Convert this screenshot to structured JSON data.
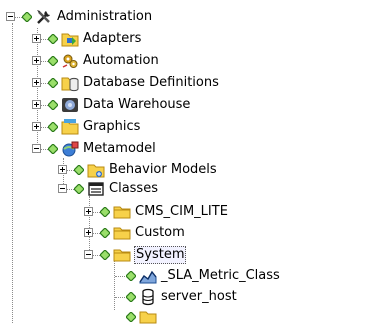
{
  "tree": {
    "nodes": [
      {
        "id": "administration",
        "label": "Administration",
        "icon": "admin-tools-icon",
        "state": "expanded"
      },
      {
        "id": "adapters",
        "label": "Adapters",
        "icon": "adapters-icon",
        "state": "collapsed"
      },
      {
        "id": "automation",
        "label": "Automation",
        "icon": "automation-icon",
        "state": "collapsed"
      },
      {
        "id": "database-definitions",
        "label": "Database Definitions",
        "icon": "database-definitions-icon",
        "state": "collapsed"
      },
      {
        "id": "data-warehouse",
        "label": "Data Warehouse",
        "icon": "data-warehouse-icon",
        "state": "collapsed"
      },
      {
        "id": "graphics",
        "label": "Graphics",
        "icon": "graphics-folder-icon",
        "state": "collapsed"
      },
      {
        "id": "metamodel",
        "label": "Metamodel",
        "icon": "metamodel-icon",
        "state": "expanded"
      },
      {
        "id": "behavior-models",
        "label": "Behavior Models",
        "icon": "behavior-models-icon",
        "state": "collapsed"
      },
      {
        "id": "classes",
        "label": "Classes",
        "icon": "classes-icon",
        "state": "expanded"
      },
      {
        "id": "cms-cim-lite",
        "label": "CMS_CIM_LITE",
        "icon": "folder-icon",
        "state": "collapsed"
      },
      {
        "id": "custom",
        "label": "Custom",
        "icon": "folder-icon",
        "state": "collapsed"
      },
      {
        "id": "system",
        "label": "System",
        "icon": "folder-icon",
        "state": "expanded",
        "selected": true
      },
      {
        "id": "sla-metric-class",
        "label": "_SLA_Metric_Class",
        "icon": "chart-class-icon",
        "state": "leaf"
      },
      {
        "id": "server-host",
        "label": "server_host",
        "icon": "database-cylinder-icon",
        "state": "leaf"
      }
    ]
  },
  "colors": {
    "diamond_fill": "#9adf6a",
    "diamond_stroke": "#2b7a1a",
    "folder_fill": "#f7d14a",
    "folder_stroke": "#b98b12",
    "selection_border": "#555555"
  }
}
